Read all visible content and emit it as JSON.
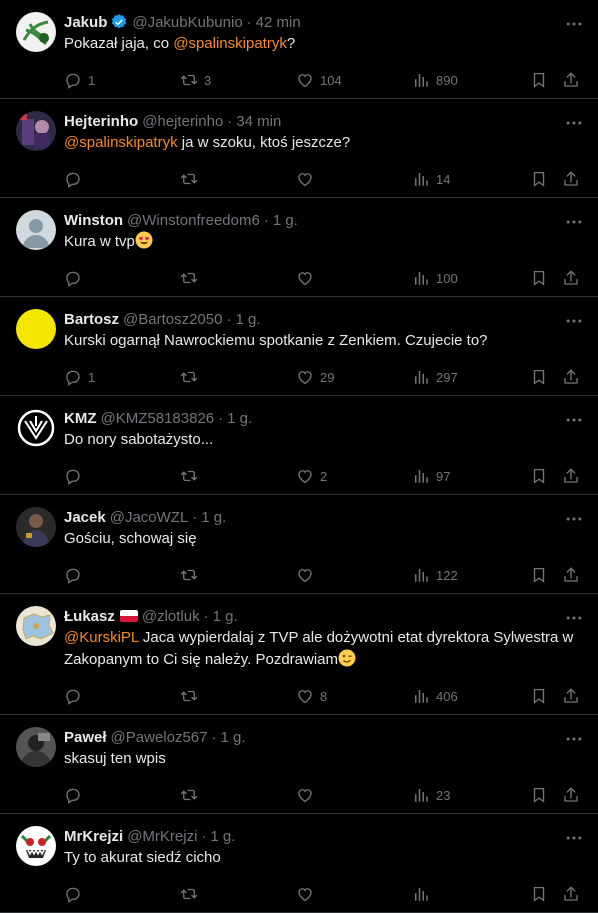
{
  "tweets": [
    {
      "name": "Jakub",
      "handle": "@JakubKubunio",
      "time": "42 min",
      "pre": "Pokazał jaja, co ",
      "mention": "@spalinskipatryk",
      "post": "?",
      "replies": "1",
      "retweets": "3",
      "likes": "104",
      "views": "890",
      "verified": true,
      "avatar": "scribble"
    },
    {
      "name": "Hejterinho",
      "handle": "@hejterinho",
      "time": "34 min",
      "pre": "",
      "mention": "@spalinskipatryk",
      "post": " ja w szoku, ktoś jeszcze?",
      "replies": "",
      "retweets": "",
      "likes": "",
      "views": "14",
      "avatar": "photo-dark"
    },
    {
      "name": "Winston",
      "handle": "@Winstonfreedom6",
      "time": "1 g.",
      "pre": "Kura w tvp",
      "mention": "",
      "post": "",
      "replies": "",
      "retweets": "",
      "likes": "",
      "views": "100",
      "avatar": "default",
      "emoji": "heart-eyes"
    },
    {
      "name": "Bartosz",
      "handle": "@Bartosz2050",
      "time": "1 g.",
      "pre": "Kurski ogarnął Nawrockiemu spotkanie z Zenkiem. Czujecie to?",
      "mention": "",
      "post": "",
      "replies": "1",
      "retweets": "",
      "likes": "29",
      "views": "297",
      "avatar": "yellow"
    },
    {
      "name": "KMZ",
      "handle": "@KMZ58183826",
      "time": "1 g.",
      "pre": "Do nory sabotażysto...",
      "mention": "",
      "post": "",
      "replies": "",
      "retweets": "",
      "likes": "2",
      "views": "97",
      "avatar": "logo"
    },
    {
      "name": "Jacek",
      "handle": "@JacoWZL",
      "time": "1 g.",
      "pre": "Gościu, schowaj się",
      "mention": "",
      "post": "",
      "replies": "",
      "retweets": "",
      "likes": "",
      "views": "122",
      "avatar": "photo-person"
    },
    {
      "name": "Łukasz",
      "handle": "@zlotluk",
      "time": "1 g.",
      "pre": "",
      "mention": "@KurskiPL",
      "post": " Jaca wypierdalaj z TVP ale dożywotni etat  dyrektora Sylwestra w Zakopanym to Ci się należy. Pozdrawiam",
      "replies": "",
      "retweets": "",
      "likes": "8",
      "views": "406",
      "avatar": "map",
      "flag": true,
      "emoji": "wink"
    },
    {
      "name": "Paweł",
      "handle": "@Paweloz567",
      "time": "1 g.",
      "pre": "skasuj ten wpis",
      "mention": "",
      "post": "",
      "replies": "",
      "retweets": "",
      "likes": "",
      "views": "23",
      "avatar": "photo-gray"
    },
    {
      "name": "MrKrejzi",
      "handle": "@MrKrejzi",
      "time": "1 g.",
      "pre": "Ty to akurat siedź cicho",
      "mention": "",
      "post": "",
      "replies": "",
      "retweets": "",
      "likes": "",
      "views": "",
      "avatar": "cartoon"
    }
  ],
  "colors": {
    "accent": "#f4882a",
    "muted": "#71767b",
    "text": "#e7e9ea",
    "border": "#2f3336",
    "verified": "#1d9bf0"
  }
}
